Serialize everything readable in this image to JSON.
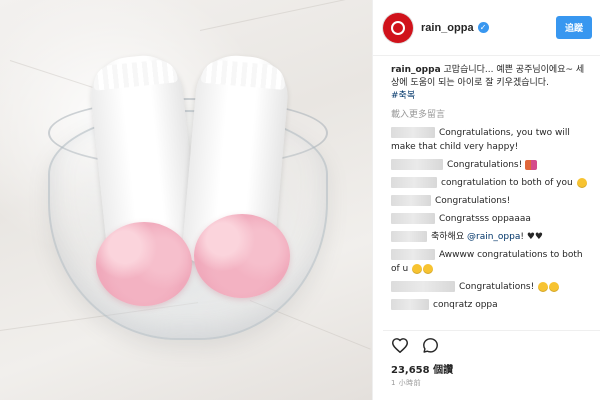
{
  "post": {
    "username": "rain_oppa",
    "follow_label": "追蹤",
    "caption_user": "rain_oppa",
    "caption_text": "고맙습니다... 예쁜 공주님이에요~ 세상에 도움이 되는 아이로 잘 키우겠습니다.",
    "hashtag": "#축복",
    "load_more": "載入更多留言",
    "likes": "23,658 個讚",
    "time_ago": "1 小時前"
  },
  "comments": [
    {
      "text": "Congratulations, you two will make that child very happy!",
      "emoji": ""
    },
    {
      "text": "Congratulations!",
      "emoji": "couple"
    },
    {
      "text": "congratulation to both of you",
      "emoji": "face"
    },
    {
      "text": "Congratulations!",
      "emoji": ""
    },
    {
      "text": "Congratsss oppaaaa",
      "emoji": ""
    },
    {
      "text_before": "축하해요",
      "mention": "@rain_oppa",
      "text_after": "!",
      "emoji": "hearts"
    },
    {
      "text": "Awwww congratulations to both of u",
      "emoji": "faces"
    },
    {
      "text": "Congratulations!",
      "emoji": "faces"
    },
    {
      "text": "conqratz oppa",
      "emoji": ""
    }
  ],
  "icons": {
    "heart": "heart-icon",
    "comment": "comment-icon",
    "verified": "verified-badge-icon"
  },
  "colors": {
    "follow_button": "#3897f0",
    "avatar": "#d0121b",
    "link": "#003569"
  }
}
